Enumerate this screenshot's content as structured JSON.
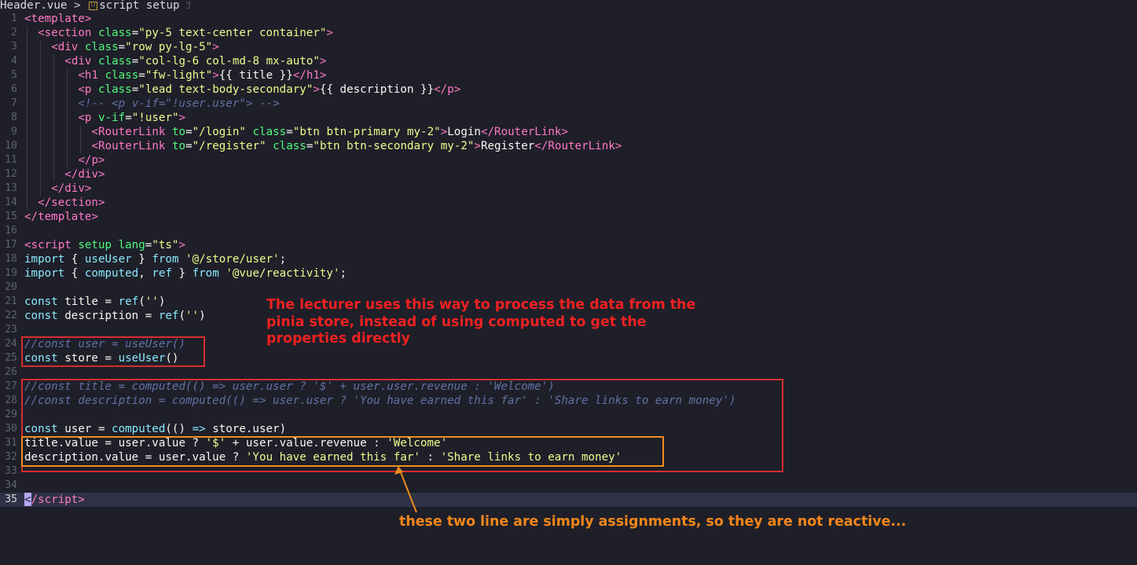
{
  "breadcrumb": {
    "file": "Header.vue",
    "separator": ">",
    "symbol_icon": "symbol-icon",
    "symbol": "script setup",
    "trailing_glyph": "ℐ"
  },
  "editor": {
    "language": "vue",
    "lines": [
      {
        "n": "1",
        "segments": [
          [
            "t",
            "<template>"
          ]
        ]
      },
      {
        "n": "2",
        "indent": 2,
        "segments": [
          [
            "t",
            "<section "
          ],
          [
            "a",
            "class"
          ],
          [
            "p",
            "="
          ],
          [
            "s",
            "\"py-5 text-center container\""
          ],
          [
            "t",
            ">"
          ]
        ]
      },
      {
        "n": "3",
        "indent": 4,
        "segments": [
          [
            "t",
            "<div "
          ],
          [
            "a",
            "class"
          ],
          [
            "p",
            "="
          ],
          [
            "s",
            "\"row py-lg-5\""
          ],
          [
            "t",
            ">"
          ]
        ]
      },
      {
        "n": "4",
        "indent": 6,
        "segments": [
          [
            "t",
            "<div "
          ],
          [
            "a",
            "class"
          ],
          [
            "p",
            "="
          ],
          [
            "s",
            "\"col-lg-6 col-md-8 mx-auto\""
          ],
          [
            "t",
            ">"
          ]
        ]
      },
      {
        "n": "5",
        "indent": 8,
        "segments": [
          [
            "t",
            "<h1 "
          ],
          [
            "a",
            "class"
          ],
          [
            "p",
            "="
          ],
          [
            "s",
            "\"fw-light\""
          ],
          [
            "t",
            ">"
          ],
          [
            "p",
            "{{ title }}"
          ],
          [
            "t",
            "</h1>"
          ]
        ]
      },
      {
        "n": "6",
        "indent": 8,
        "segments": [
          [
            "t",
            "<p "
          ],
          [
            "a",
            "class"
          ],
          [
            "p",
            "="
          ],
          [
            "s",
            "\"lead text-body-secondary\""
          ],
          [
            "t",
            ">"
          ],
          [
            "p",
            "{{ description }}"
          ],
          [
            "t",
            "</p>"
          ]
        ]
      },
      {
        "n": "7",
        "indent": 8,
        "segments": [
          [
            "c",
            "<!-- <p v-if=\"!user.user\"> -->"
          ]
        ]
      },
      {
        "n": "8",
        "indent": 8,
        "segments": [
          [
            "t",
            "<p "
          ],
          [
            "a",
            "v-if"
          ],
          [
            "p",
            "="
          ],
          [
            "s",
            "\"!user\""
          ],
          [
            "t",
            ">"
          ]
        ]
      },
      {
        "n": "9",
        "indent": 10,
        "segments": [
          [
            "t",
            "<RouterLink "
          ],
          [
            "a",
            "to"
          ],
          [
            "p",
            "="
          ],
          [
            "s",
            "\"/login\" "
          ],
          [
            "a",
            "class"
          ],
          [
            "p",
            "="
          ],
          [
            "s",
            "\"btn btn-primary my-2\""
          ],
          [
            "t",
            ">"
          ],
          [
            "p",
            "Login"
          ],
          [
            "t",
            "</RouterLink>"
          ]
        ]
      },
      {
        "n": "10",
        "indent": 10,
        "segments": [
          [
            "t",
            "<RouterLink "
          ],
          [
            "a",
            "to"
          ],
          [
            "p",
            "="
          ],
          [
            "s",
            "\"/register\" "
          ],
          [
            "a",
            "class"
          ],
          [
            "p",
            "="
          ],
          [
            "s",
            "\"btn btn-secondary my-2\""
          ],
          [
            "t",
            ">"
          ],
          [
            "p",
            "Register"
          ],
          [
            "t",
            "</RouterLink>"
          ]
        ]
      },
      {
        "n": "11",
        "indent": 8,
        "segments": [
          [
            "t",
            "</p>"
          ]
        ]
      },
      {
        "n": "12",
        "indent": 6,
        "segments": [
          [
            "t",
            "</div>"
          ]
        ]
      },
      {
        "n": "13",
        "indent": 4,
        "segments": [
          [
            "t",
            "</div>"
          ]
        ]
      },
      {
        "n": "14",
        "indent": 2,
        "segments": [
          [
            "t",
            "</section>"
          ]
        ]
      },
      {
        "n": "15",
        "segments": [
          [
            "t",
            "</template>"
          ]
        ]
      },
      {
        "n": "16",
        "segments": []
      },
      {
        "n": "17",
        "segments": [
          [
            "t",
            "<script "
          ],
          [
            "a",
            "setup "
          ],
          [
            "a",
            "lang"
          ],
          [
            "p",
            "="
          ],
          [
            "s",
            "\"ts\""
          ],
          [
            "t",
            ">"
          ]
        ]
      },
      {
        "n": "18",
        "segments": [
          [
            "k",
            "import "
          ],
          [
            "p",
            "{ "
          ],
          [
            "k",
            "useUser "
          ],
          [
            "p",
            "} "
          ],
          [
            "k",
            "from "
          ],
          [
            "s",
            "'@/store/user'"
          ],
          [
            "p",
            ";"
          ]
        ]
      },
      {
        "n": "19",
        "segments": [
          [
            "k",
            "import "
          ],
          [
            "p",
            "{ "
          ],
          [
            "k",
            "computed"
          ],
          [
            "p",
            ", "
          ],
          [
            "k",
            "ref "
          ],
          [
            "p",
            "} "
          ],
          [
            "k",
            "from "
          ],
          [
            "s",
            "'@vue/reactivity'"
          ],
          [
            "p",
            ";"
          ]
        ]
      },
      {
        "n": "20",
        "segments": []
      },
      {
        "n": "21",
        "segments": [
          [
            "k",
            "const "
          ],
          [
            "p",
            "title = "
          ],
          [
            "k",
            "ref"
          ],
          [
            "p",
            "("
          ],
          [
            "s",
            "''"
          ],
          [
            "p",
            ")"
          ]
        ]
      },
      {
        "n": "22",
        "segments": [
          [
            "k",
            "const "
          ],
          [
            "p",
            "description = "
          ],
          [
            "k",
            "ref"
          ],
          [
            "p",
            "("
          ],
          [
            "s",
            "''"
          ],
          [
            "p",
            ")"
          ]
        ]
      },
      {
        "n": "23",
        "segments": []
      },
      {
        "n": "24",
        "segments": [
          [
            "c",
            "//const user = useUser()"
          ]
        ]
      },
      {
        "n": "25",
        "segments": [
          [
            "k",
            "const "
          ],
          [
            "p",
            "store = "
          ],
          [
            "k",
            "useUser"
          ],
          [
            "p",
            "()"
          ]
        ]
      },
      {
        "n": "26",
        "segments": []
      },
      {
        "n": "27",
        "segments": [
          [
            "c",
            "//const title = computed(() => user.user ? '$' + user.user.revenue : 'Welcome')"
          ]
        ]
      },
      {
        "n": "28",
        "segments": [
          [
            "c",
            "//const description = computed(() => user.user ? 'You have earned this far' : 'Share links to earn money')"
          ]
        ]
      },
      {
        "n": "29",
        "segments": []
      },
      {
        "n": "30",
        "segments": [
          [
            "k",
            "const "
          ],
          [
            "p",
            "user = "
          ],
          [
            "k",
            "computed"
          ],
          [
            "p",
            "(() "
          ],
          [
            "k",
            "=> "
          ],
          [
            "p",
            "store.user)"
          ]
        ]
      },
      {
        "n": "31",
        "segments": [
          [
            "p",
            "title.value = user.value ? "
          ],
          [
            "s",
            "'$'"
          ],
          [
            "p",
            " + user.value.revenue : "
          ],
          [
            "s",
            "'Welcome'"
          ]
        ]
      },
      {
        "n": "32",
        "segments": [
          [
            "p",
            "description.value = user.value ? "
          ],
          [
            "s",
            "'You have earned this far'"
          ],
          [
            "p",
            " : "
          ],
          [
            "s",
            "'Share links to earn money'"
          ]
        ]
      },
      {
        "n": "33",
        "segments": []
      },
      {
        "n": "34",
        "segments": []
      },
      {
        "n": "35",
        "current": true,
        "segments": [
          [
            "caret",
            "<"
          ],
          [
            "t",
            "/script>"
          ]
        ]
      }
    ]
  },
  "annotations": {
    "red_note": "The lecturer uses this way to process the data from the pinia store, instead of using computed to get the properties directly",
    "orange_note": "these two line are simply assignments, so they are not reactive..."
  },
  "colors": {
    "background": "#1e1f29",
    "current_line": "#2e3244",
    "annotation_red": "#ef2121",
    "annotation_orange": "#f0861a"
  }
}
